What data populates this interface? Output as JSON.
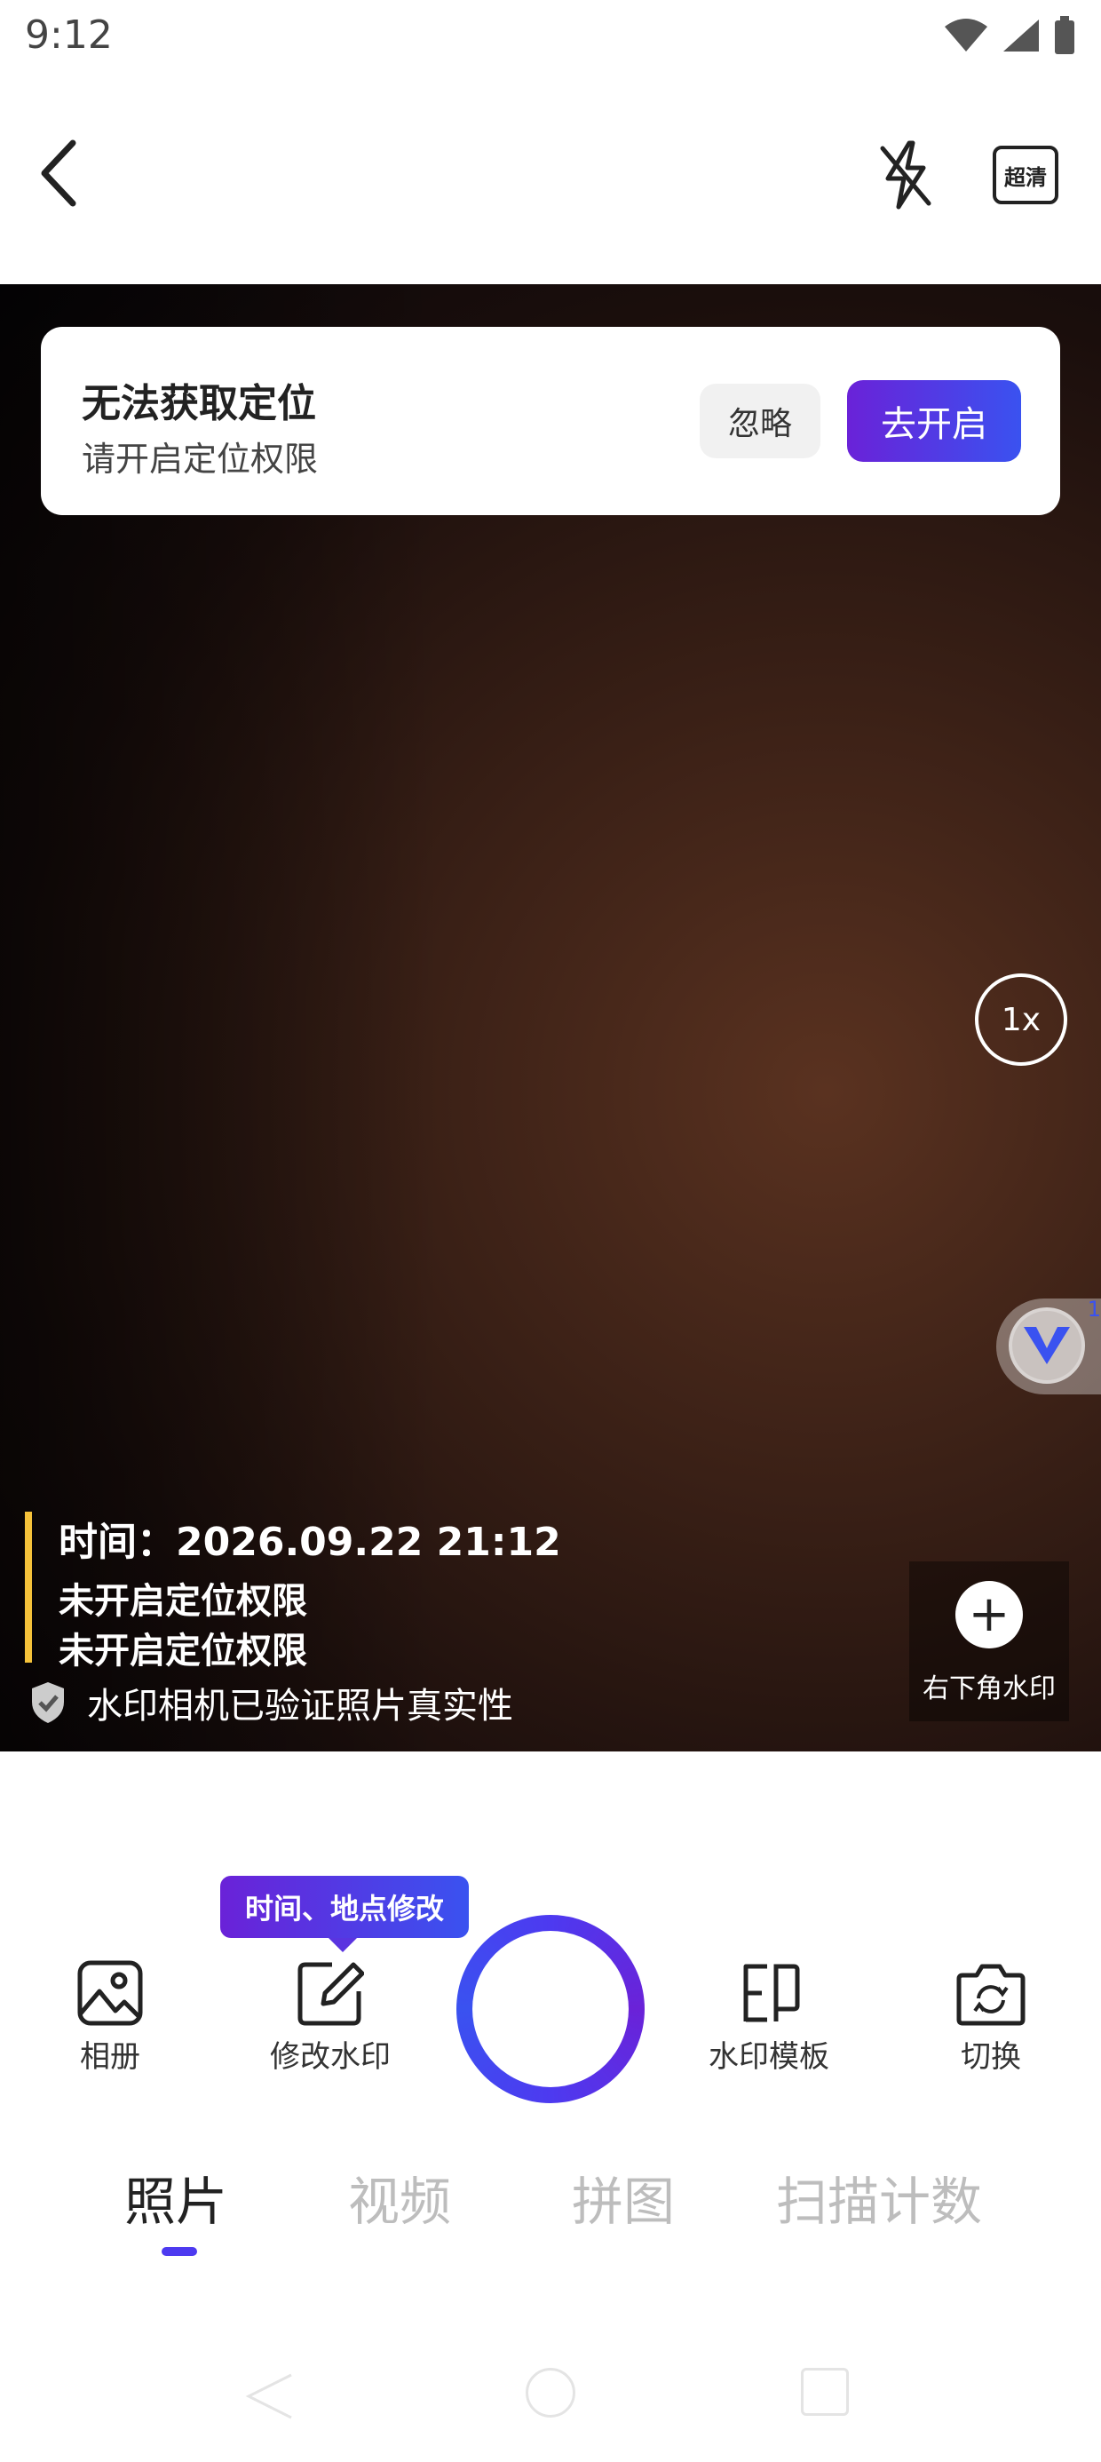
{
  "status_bar": {
    "time": "9:12"
  },
  "top_bar": {
    "hd_label": "超清"
  },
  "location_card": {
    "title": "无法获取定位",
    "subtitle": "请开启定位权限",
    "ignore_label": "忽略",
    "enable_label": "去开启"
  },
  "zoom": {
    "label": "1x"
  },
  "float_badge": {
    "count": "1"
  },
  "watermark": {
    "time_line": "时间：2026.09.22 21:12",
    "location_line1": "未开启定位权限",
    "location_line2": "未开启定位权限",
    "verify_text": "水印相机已验证照片真实性",
    "corner_label": "右下角水印"
  },
  "tooltip": {
    "text": "时间、地点修改"
  },
  "controls": {
    "album": "相册",
    "edit_watermark": "修改水印",
    "template": "水印模板",
    "switch": "切换"
  },
  "mode_tabs": [
    "照片",
    "视频",
    "拼图",
    "扫描计数"
  ],
  "active_tab": "照片",
  "colors": {
    "accent_purple": "#6a22d8",
    "accent_blue": "#3a52f0",
    "watermark_bar": "#f5c23a"
  }
}
